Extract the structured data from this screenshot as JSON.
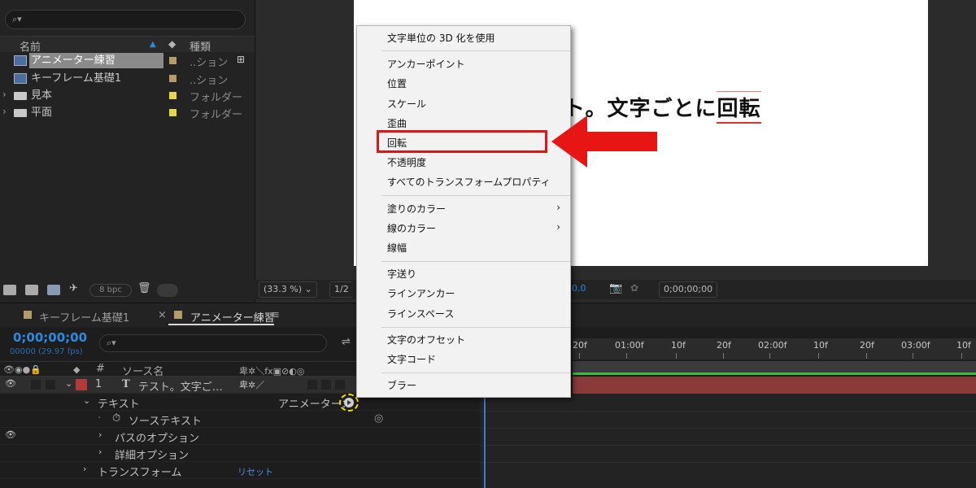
{
  "project": {
    "search_icon": "⌕▾",
    "col_name": "名前",
    "col_type": "種類",
    "items": [
      {
        "name": "アニメーター練習",
        "type": "..ション",
        "icon": "composition-icon",
        "tag": "#b59a6a"
      },
      {
        "name": "キーフレーム基礎1",
        "type": "..ション",
        "icon": "composition-icon",
        "tag": "#b59a6a"
      },
      {
        "name": "見本",
        "type": "フォルダー",
        "icon": "folder-icon",
        "tag": "#e6d44a"
      },
      {
        "name": "平面",
        "type": "フォルダー",
        "icon": "folder-icon",
        "tag": "#e6d44a"
      }
    ],
    "bpc": "8 bpc"
  },
  "viewer": {
    "canvas_text_prefix": "ト。文字ごとに",
    "canvas_text_highlight": "回転",
    "zoom": "(33.3 %)",
    "resolution": "1/2",
    "exposure": "0.0",
    "timecode": "0;00;00;00"
  },
  "timeline": {
    "tabs": [
      {
        "label": "キーフレーム基礎1",
        "color": "#b59a6a"
      },
      {
        "label": "アニメーター練習",
        "color": "#b59a6a"
      }
    ],
    "close_glyph": "×",
    "menu_glyph": "≡",
    "timecode": "0;00;00;00",
    "fps": "00000 (29.97 fps)",
    "col_number": "#",
    "col_source": "ソース名",
    "layer": {
      "number": "1",
      "name": "テスト。文字ご…"
    },
    "rows": {
      "text": "テキスト",
      "animate": "アニメーター：",
      "source_text": "ソーステキスト",
      "path_options": "パスのオプション",
      "more_options": "詳細オプション",
      "transform": "トランスフォーム",
      "reset": "リセット"
    },
    "ruler": [
      "20f",
      "01:00f",
      "10f",
      "20f",
      "02:00f",
      "10f",
      "20f",
      "03:00f",
      "10f"
    ]
  },
  "menu": {
    "groups": [
      [
        "文字単位の 3D 化を使用"
      ],
      [
        "アンカーポイント",
        "位置",
        "スケール",
        "歪曲",
        "回転",
        "不透明度",
        "すべてのトランスフォームプロパティ"
      ],
      [
        "塗りのカラー",
        "線のカラー",
        "線幅"
      ],
      [
        "字送り",
        "ラインアンカー",
        "ラインスペース"
      ],
      [
        "文字のオフセット",
        "文字コード"
      ],
      [
        "ブラー"
      ]
    ],
    "submenu_glyph": "›"
  },
  "colors": {
    "accent_blue": "#2b8ae0",
    "highlight_red": "#e01515",
    "layer_bar": "#8b3a3a",
    "animate_button_outline": "#f0e000"
  }
}
